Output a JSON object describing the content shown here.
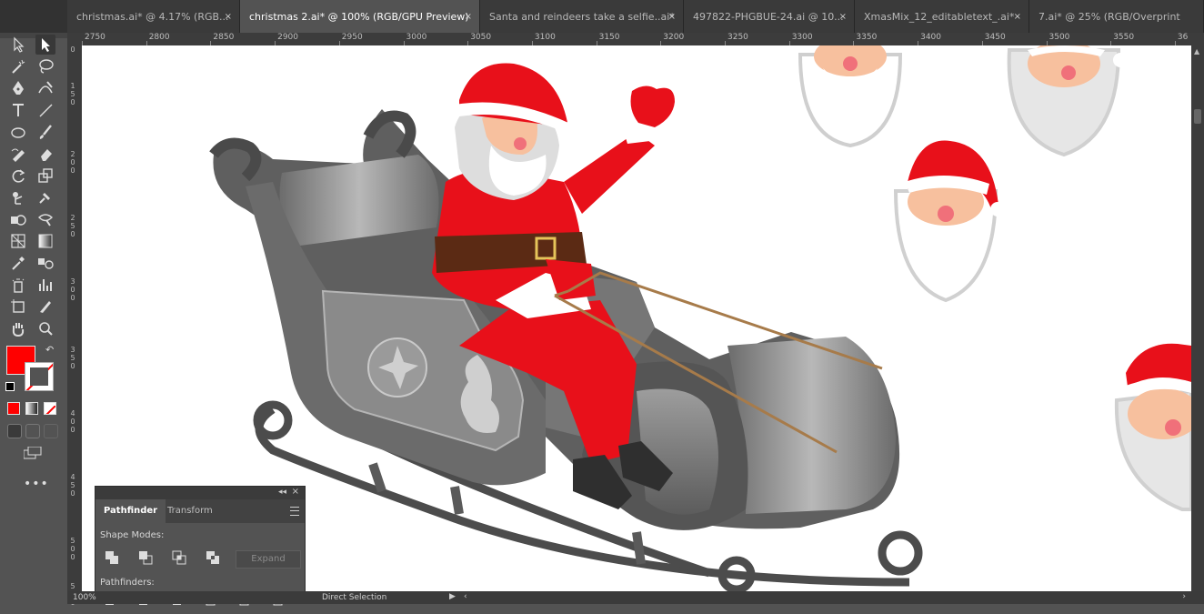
{
  "tabs": [
    {
      "label": "christmas.ai* @ 4.17% (RGB..."
    },
    {
      "label": "christmas 2.ai* @ 100% (RGB/GPU Preview)",
      "active": true
    },
    {
      "label": "Santa and reindeers take a selfie..ai*"
    },
    {
      "label": "497822-PHGBUE-24.ai @ 10..."
    },
    {
      "label": "XmasMix_12_editabletext_.ai*"
    },
    {
      "label": "7.ai* @ 25% (RGB/Overprint"
    }
  ],
  "tab_close": "×",
  "ruler": {
    "top_ticks": [
      "2750",
      "2800",
      "2850",
      "2900",
      "2950",
      "3000",
      "3050",
      "3100",
      "3150",
      "3200",
      "3250",
      "3300",
      "3350",
      "3400",
      "3450",
      "3500",
      "3550",
      "36"
    ],
    "left_ticks": [
      "0",
      "1\n5\n0",
      "2\n0\n0",
      "2\n5\n0",
      "3\n0\n0",
      "3\n5\n0",
      "4\n0\n0",
      "4\n5\n0",
      "5\n0\n0",
      "5\n5\n0"
    ]
  },
  "colors": {
    "fill": "#ff0000",
    "stroke": "#ffffff",
    "santa_red": "#e8101a",
    "sleigh_grey": "#7a7a7a",
    "rein": "#a77b4a"
  },
  "panel": {
    "tabs": [
      "Pathfinder",
      "Transform"
    ],
    "shape_modes_label": "Shape Modes:",
    "expand_label": "Expand",
    "pathfinders_label": "Pathfinders:"
  },
  "status": {
    "zoom": "100%",
    "tool": "Direct Selection"
  },
  "icons": [
    "selection-tool-icon",
    "direct-selection-tool-icon",
    "magic-wand-icon",
    "lasso-icon",
    "pen-icon",
    "curvature-icon",
    "type-icon",
    "line-icon",
    "ellipse-icon",
    "paintbrush-icon",
    "shaper-icon",
    "eraser-icon",
    "rotate-icon",
    "scale-icon",
    "puppet-warp-icon",
    "free-transform-icon",
    "shape-builder-icon",
    "live-paint-icon",
    "perspective-grid-icon",
    "gradient-icon",
    "eyedropper-icon",
    "blend-icon",
    "symbol-sprayer-icon",
    "column-graph-icon",
    "artboard-icon",
    "slice-icon",
    "hand-icon",
    "zoom-icon"
  ]
}
